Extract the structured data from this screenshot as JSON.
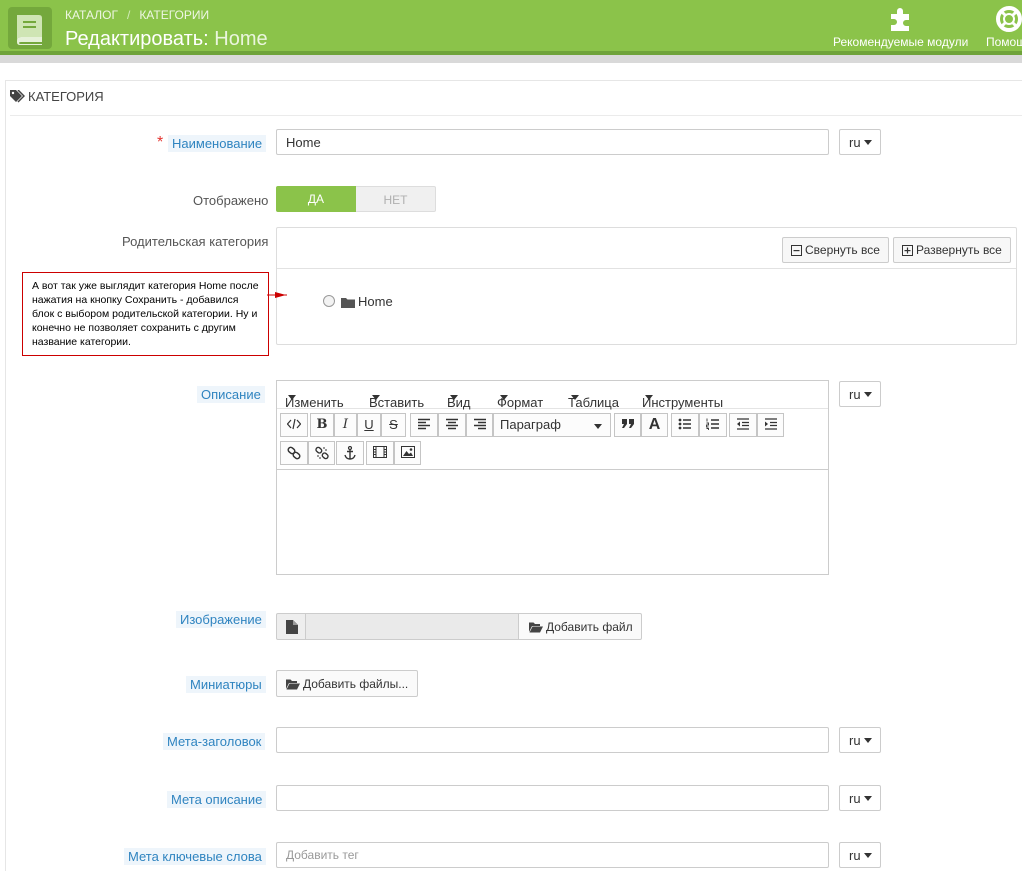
{
  "header": {
    "breadcrumb": [
      "КАТАЛОГ",
      "КАТЕГОРИИ"
    ],
    "breadcrumb_sep": "/",
    "title_action": "Редактировать:",
    "title_object": "Home",
    "buttons": [
      {
        "label": "Рекомендуемые модули",
        "icon": "puzzle-icon"
      },
      {
        "label": "Помощь",
        "icon": "lifebuoy-icon"
      }
    ],
    "brand_color": "#8bc34a"
  },
  "panel": {
    "title": "КАТЕГОРИЯ",
    "icon": "tags-icon"
  },
  "fields": {
    "name": {
      "required_mark": "*",
      "label": "Наименование",
      "value": "Home",
      "lang": "ru"
    },
    "active": {
      "label": "Отображено",
      "on_label": "ДА",
      "off_label": "НЕТ",
      "selected": "ДА"
    },
    "parent": {
      "label": "Родительская категория",
      "collapse_label": "Свернуть все",
      "expand_label": "Развернуть все",
      "tree": [
        {
          "label": "Home",
          "icon": "folder-icon"
        }
      ]
    },
    "description": {
      "label": "Описание",
      "lang": "ru",
      "menu": [
        "Изменить",
        "Вставить",
        "Вид",
        "Формат",
        "Таблица",
        "Инструменты"
      ],
      "format_select": "Параграф",
      "toolbar_icons": [
        "code-icon",
        "bold-icon",
        "italic-icon",
        "underline-icon",
        "strikethrough-icon",
        "align-left-icon",
        "align-center-icon",
        "align-right-icon",
        "blockquote-icon",
        "text-color-icon",
        "bullet-list-icon",
        "numbered-list-icon",
        "outdent-icon",
        "indent-icon",
        "link-icon",
        "unlink-icon",
        "anchor-icon",
        "media-icon",
        "image-icon"
      ]
    },
    "image": {
      "label": "Изображение",
      "button": "Добавить файл"
    },
    "thumbnails": {
      "label": "Миниатюры",
      "button": "Добавить файлы..."
    },
    "meta_title": {
      "label": "Мета-заголовок",
      "value": "",
      "lang": "ru"
    },
    "meta_description": {
      "label": "Мета описание",
      "value": "",
      "lang": "ru"
    },
    "meta_keywords": {
      "label": "Мета ключевые слова",
      "placeholder": "Добавить тег",
      "lang": "ru"
    }
  },
  "annotation": {
    "text": "А вот так уже выглядит категория Home после нажатия на кнопку Сохранить - добавился блок с выбором родительской категории. Ну и конечно не позволяет сохранить с другим название категории.",
    "border_color": "#cc0000"
  }
}
